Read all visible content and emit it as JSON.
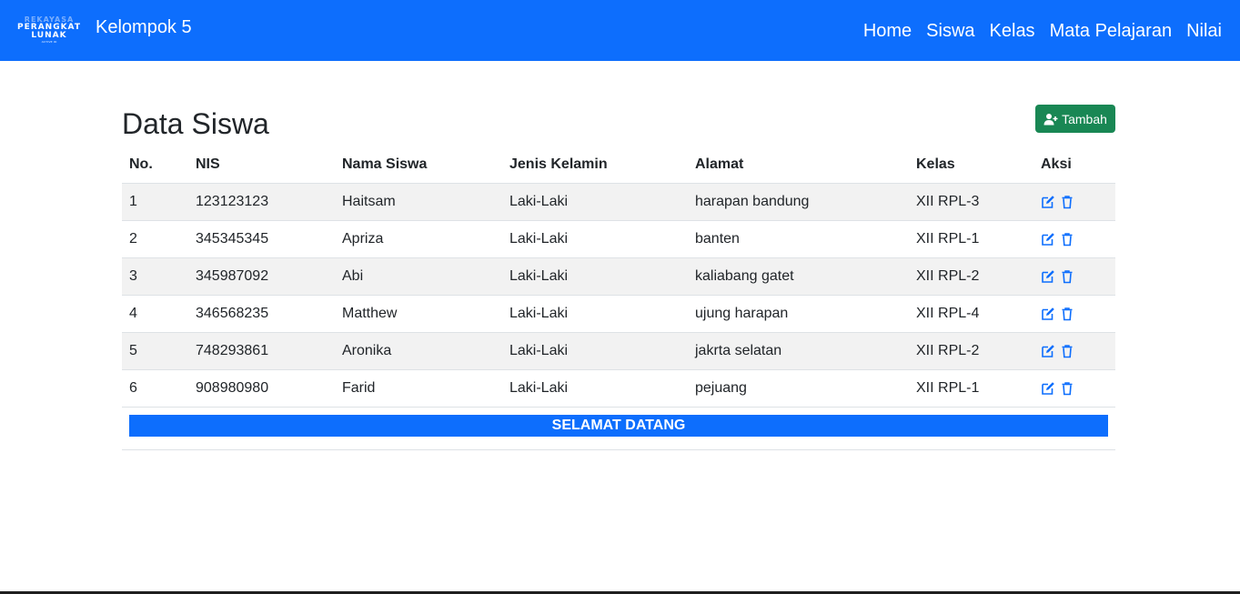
{
  "navbar": {
    "logo_text": [
      "REKAYASA",
      "PERANGKAT",
      "LUNAK",
      "ACTIVE ID"
    ],
    "brand": "Kelompok 5",
    "links": [
      "Home",
      "Siswa",
      "Kelas",
      "Mata Pelajaran",
      "Nilai"
    ]
  },
  "main": {
    "title": "Data Siswa",
    "add_button": {
      "label": "Tambah",
      "icon": "user-plus-icon"
    }
  },
  "table": {
    "headers": [
      "No.",
      "NIS",
      "Nama Siswa",
      "Jenis Kelamin",
      "Alamat",
      "Kelas",
      "Aksi"
    ],
    "rows": [
      {
        "no": "1",
        "nis": "123123123",
        "nama": "Haitsam",
        "jk": "Laki-Laki",
        "alamat": "harapan bandung",
        "kelas": "XII RPL-3"
      },
      {
        "no": "2",
        "nis": "345345345",
        "nama": "Apriza",
        "jk": "Laki-Laki",
        "alamat": "banten",
        "kelas": "XII RPL-1"
      },
      {
        "no": "3",
        "nis": "345987092",
        "nama": "Abi",
        "jk": "Laki-Laki",
        "alamat": "kaliabang gatet",
        "kelas": "XII RPL-2"
      },
      {
        "no": "4",
        "nis": "346568235",
        "nama": "Matthew",
        "jk": "Laki-Laki",
        "alamat": "ujung harapan",
        "kelas": "XII RPL-4"
      },
      {
        "no": "5",
        "nis": "748293861",
        "nama": "Aronika",
        "jk": "Laki-Laki",
        "alamat": "jakrta selatan",
        "kelas": "XII RPL-2"
      },
      {
        "no": "6",
        "nis": "908980980",
        "nama": "Farid",
        "jk": "Laki-Laki",
        "alamat": "pejuang",
        "kelas": "XII RPL-1"
      }
    ],
    "action_icons": [
      "edit-icon",
      "trash-icon"
    ]
  },
  "footer": {
    "banner": "SELAMAT DATANG"
  },
  "colors": {
    "primary": "#0d6efd",
    "success": "#198754",
    "stripe": "#f2f2f2",
    "text": "#212529"
  }
}
